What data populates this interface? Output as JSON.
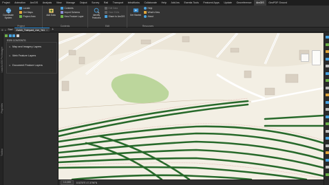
{
  "ribbon_tabs": [
    "Project",
    "Animation",
    "ArcGIS",
    "Analysis",
    "View",
    "Manage",
    "Output",
    "Survey",
    "Rail",
    "Transport",
    "InfraWorks",
    "Collaborate",
    "Help",
    "Add-Ins",
    "Esentia Tools",
    "Featured Apps",
    "Update",
    "Georeference",
    "ArcGIS",
    "GeoPDF Ground"
  ],
  "active_tab_index": 18,
  "ribbon": {
    "project": {
      "title": "Project",
      "big": "Coordinate System",
      "small": [
        "Locate",
        "Get Maps",
        "Project Area"
      ]
    },
    "contents": {
      "title": "Contents",
      "big": "Add Data",
      "small": [
        "Contents",
        "Import Schema",
        "New Feature Layer"
      ]
    },
    "edit": {
      "title": "Edit",
      "big": "Identify Features",
      "small": [
        "Edit Data",
        "Save Edits",
        "Share to ArcGIS"
      ]
    },
    "resources": {
      "title": "Resources",
      "big": "Get Started",
      "small": [
        "Help",
        "What's New",
        "About"
      ]
    }
  },
  "toolbar": {
    "start_label": "Start",
    "map_tab_label": "Zurich_Trainyard_Live_YA1",
    "close_glyph": "×",
    "add_tab_glyph": "+"
  },
  "rail": {
    "labels": [
      "Load ArcGIS Pro Manager",
      "Properties",
      "Toolbox"
    ]
  },
  "contents_pane": {
    "title": "ESRI CONTENTS",
    "layers": [
      "Map and Imagery Layers",
      "Web Feature Layers",
      "Document Feature Layers"
    ]
  },
  "status": {
    "scale": "1:1,000",
    "coords": "8.5275°E 47.3796°N"
  },
  "colors": {
    "accent": "#2f8fd9",
    "track": "#27692a",
    "park": "#bcd69c",
    "map_bg": "#f3efe4"
  },
  "icons": {
    "coordinate_system": "globe-icon",
    "add_data": "add-data-icon",
    "identify": "identify-icon",
    "get_started": "get-started-icon"
  }
}
